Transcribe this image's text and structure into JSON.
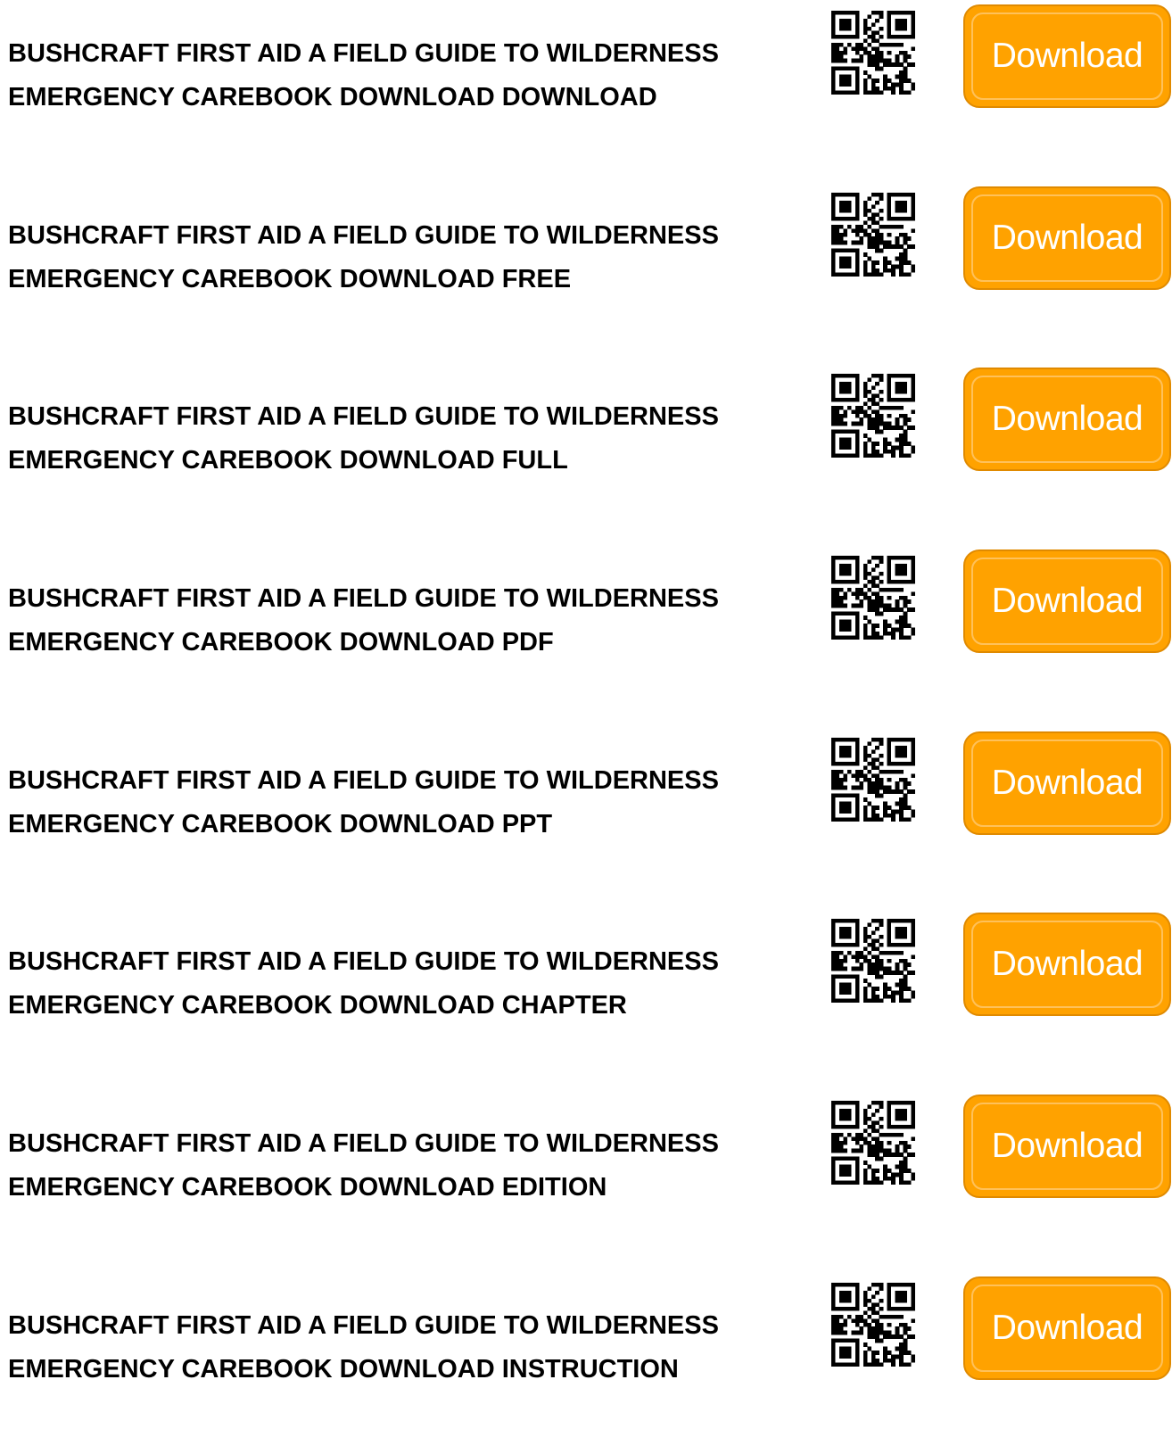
{
  "colors": {
    "button_fill": "#ffa200",
    "button_text": "#ffffff",
    "title_text": "#000000"
  },
  "qr_icon": "qr-code-icon",
  "items": [
    {
      "line1": "BUSHCRAFT FIRST AID A FIELD GUIDE TO WILDERNESS",
      "line2": "EMERGENCY CAREBOOK DOWNLOAD DOWNLOAD",
      "button_label": "Download"
    },
    {
      "line1": "BUSHCRAFT FIRST AID A FIELD GUIDE TO WILDERNESS",
      "line2": "EMERGENCY CAREBOOK DOWNLOAD FREE",
      "button_label": "Download"
    },
    {
      "line1": "BUSHCRAFT FIRST AID A FIELD GUIDE TO WILDERNESS",
      "line2": "EMERGENCY CAREBOOK DOWNLOAD FULL",
      "button_label": "Download"
    },
    {
      "line1": "BUSHCRAFT FIRST AID A FIELD GUIDE TO WILDERNESS",
      "line2": "EMERGENCY CAREBOOK DOWNLOAD PDF",
      "button_label": "Download"
    },
    {
      "line1": "BUSHCRAFT FIRST AID A FIELD GUIDE TO WILDERNESS",
      "line2": "EMERGENCY CAREBOOK DOWNLOAD PPT",
      "button_label": "Download"
    },
    {
      "line1": "BUSHCRAFT FIRST AID A FIELD GUIDE TO WILDERNESS",
      "line2": "EMERGENCY CAREBOOK DOWNLOAD CHAPTER",
      "button_label": "Download"
    },
    {
      "line1": "BUSHCRAFT FIRST AID A FIELD GUIDE TO WILDERNESS",
      "line2": "EMERGENCY CAREBOOK DOWNLOAD EDITION",
      "button_label": "Download"
    },
    {
      "line1": "BUSHCRAFT FIRST AID A FIELD GUIDE TO WILDERNESS",
      "line2": "EMERGENCY CAREBOOK DOWNLOAD INSTRUCTION",
      "button_label": "Download"
    }
  ]
}
